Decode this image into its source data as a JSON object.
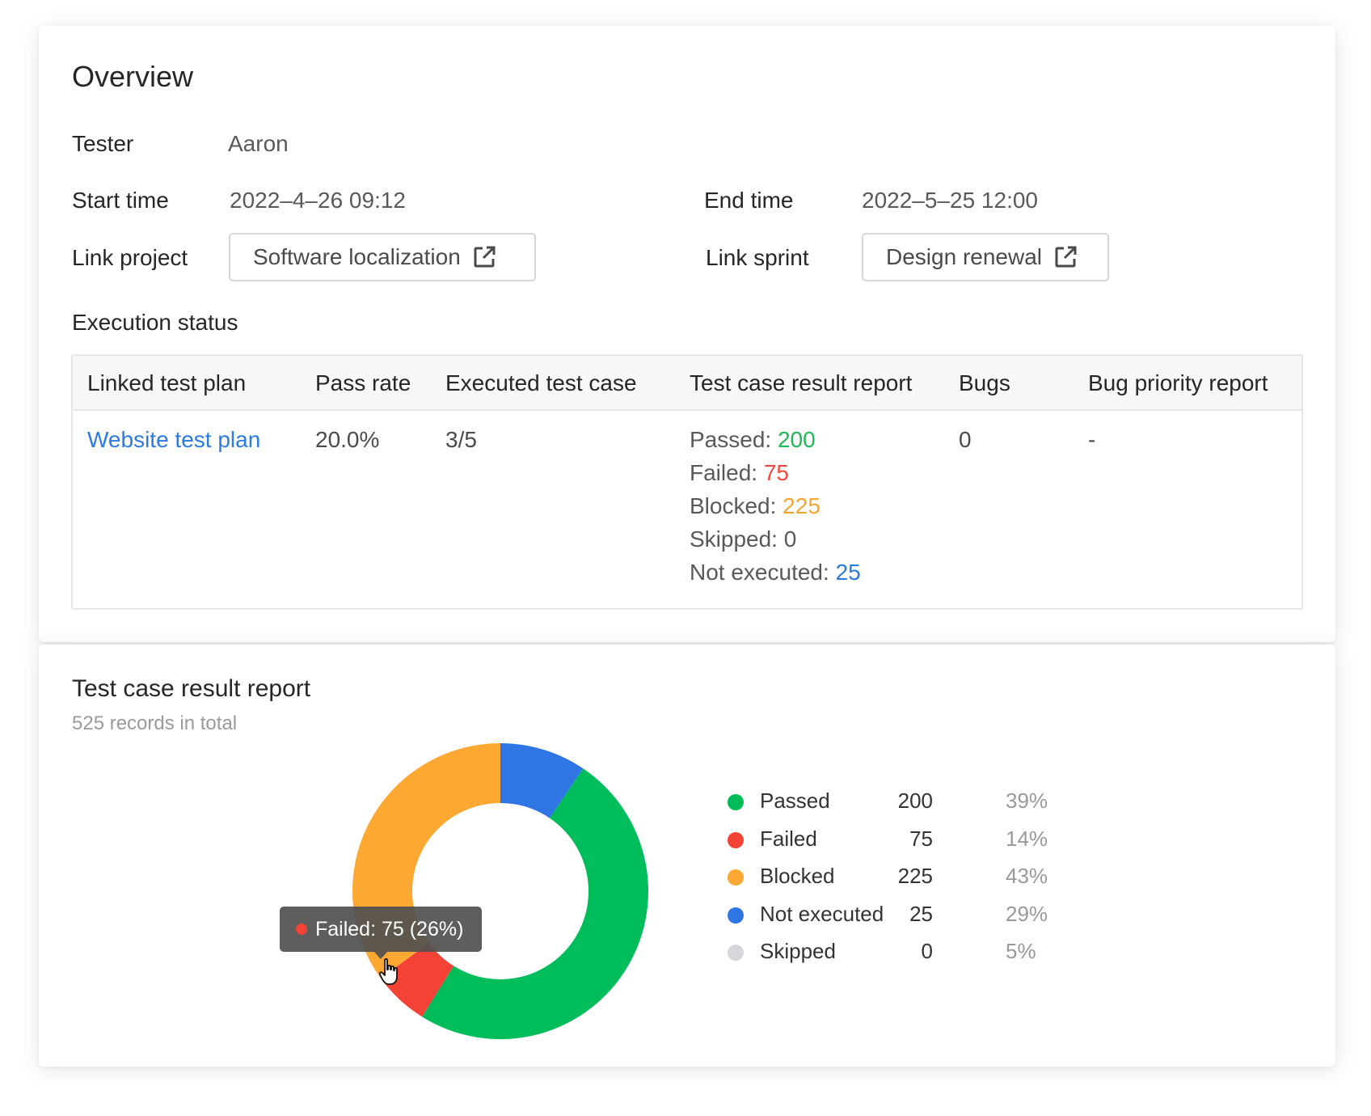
{
  "overview": {
    "title": "Overview",
    "tester_label": "Tester",
    "tester_value": "Aaron",
    "start_label": "Start time",
    "start_value": "2022–4–26 09:12",
    "end_label": "End time",
    "end_value": "2022–5–25 12:00",
    "project_label": "Link project",
    "project_value": "Software localization",
    "sprint_label": "Link sprint",
    "sprint_value": "Design renewal",
    "execution_title": "Execution status"
  },
  "table": {
    "headers": [
      "Linked test plan",
      "Pass rate",
      "Executed test case",
      "Test case result report",
      "Bugs",
      "Bug priority report"
    ],
    "row": {
      "plan": "Website test plan",
      "pass_rate": "20.0%",
      "executed": "3/5",
      "results": [
        {
          "label": "Passed: ",
          "value": "200",
          "color": "#1db954"
        },
        {
          "label": "Failed: ",
          "value": "75",
          "color": "#f0483e"
        },
        {
          "label": "Blocked: ",
          "value": "225",
          "color": "#f7a531"
        },
        {
          "label": "Skipped: ",
          "value": "0",
          "color": "#595959"
        },
        {
          "label": "Not executed: ",
          "value": "25",
          "color": "#2a7be4"
        }
      ],
      "bugs": "0",
      "bug_priority": "-"
    }
  },
  "report": {
    "title": "Test case result report",
    "subtitle": "525 records in total",
    "tooltip": "Failed: 75 (26%)"
  },
  "chart_data": {
    "type": "pie",
    "donut": true,
    "categories": [
      "Passed",
      "Failed",
      "Blocked",
      "Not executed",
      "Skipped"
    ],
    "values": [
      200,
      75,
      225,
      25,
      0
    ],
    "percent_labels": [
      "39%",
      "14%",
      "43%",
      "29%",
      "5%"
    ],
    "colors": [
      "#00bd5c",
      "#f44336",
      "#fca833",
      "#2f76e4",
      "#d5d7db"
    ],
    "legend_position": "right",
    "slice_order": [
      "Not executed",
      "Passed",
      "Failed",
      "Blocked"
    ],
    "slice_degrees": [
      34,
      178,
      22,
      126
    ]
  }
}
